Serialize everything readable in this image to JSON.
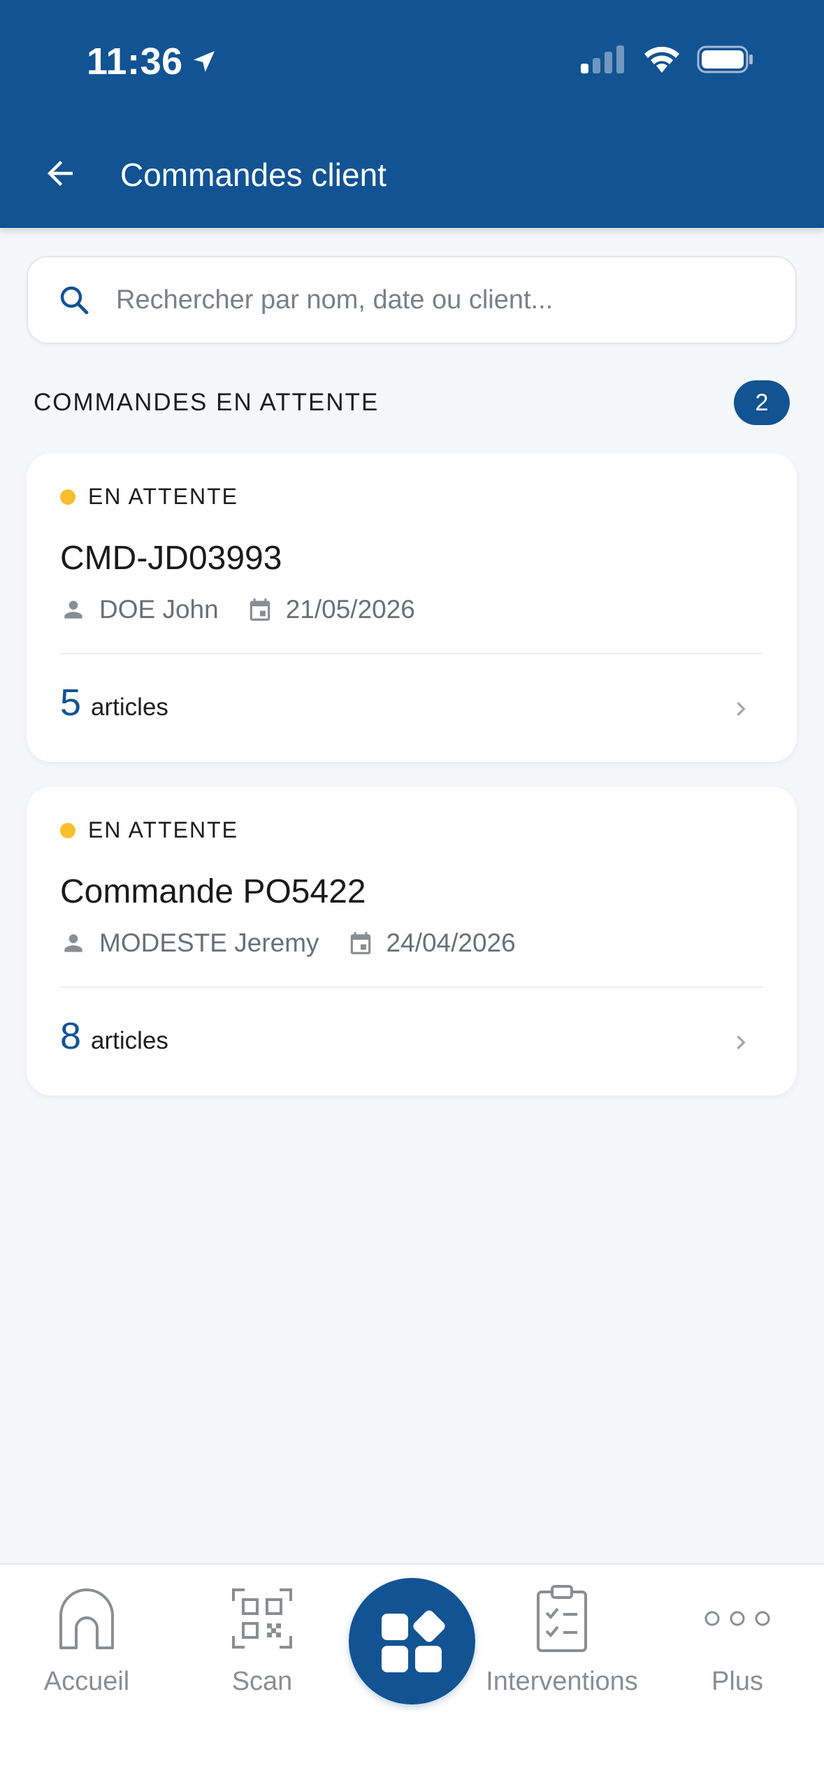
{
  "status_bar": {
    "time": "11:36"
  },
  "header": {
    "title": "Commandes client",
    "background_color": "#125393"
  },
  "search": {
    "placeholder": "Rechercher par nom, date ou client...",
    "value": ""
  },
  "section": {
    "title": "COMMANDES EN ATTENTE",
    "count": "2"
  },
  "orders": [
    {
      "status": "EN ATTENTE",
      "status_color": "#f9be2e",
      "name": "CMD-JD03993",
      "client": "DOE John",
      "date": "21/05/2026",
      "articles_count": "5",
      "articles_label": "articles"
    },
    {
      "status": "EN ATTENTE",
      "status_color": "#f9be2e",
      "name": "Commande PO5422",
      "client": "MODESTE Jeremy",
      "date": "24/04/2026",
      "articles_count": "8",
      "articles_label": "articles"
    }
  ],
  "bottom_nav": {
    "items": [
      {
        "label": "Accueil",
        "icon": "home-icon"
      },
      {
        "label": "Scan",
        "icon": "qr-scan-icon"
      },
      {
        "label": "",
        "icon": "apps-grid-icon"
      },
      {
        "label": "Interventions",
        "icon": "clipboard-checklist-icon"
      },
      {
        "label": "Plus",
        "icon": "more-dots-icon"
      }
    ]
  }
}
